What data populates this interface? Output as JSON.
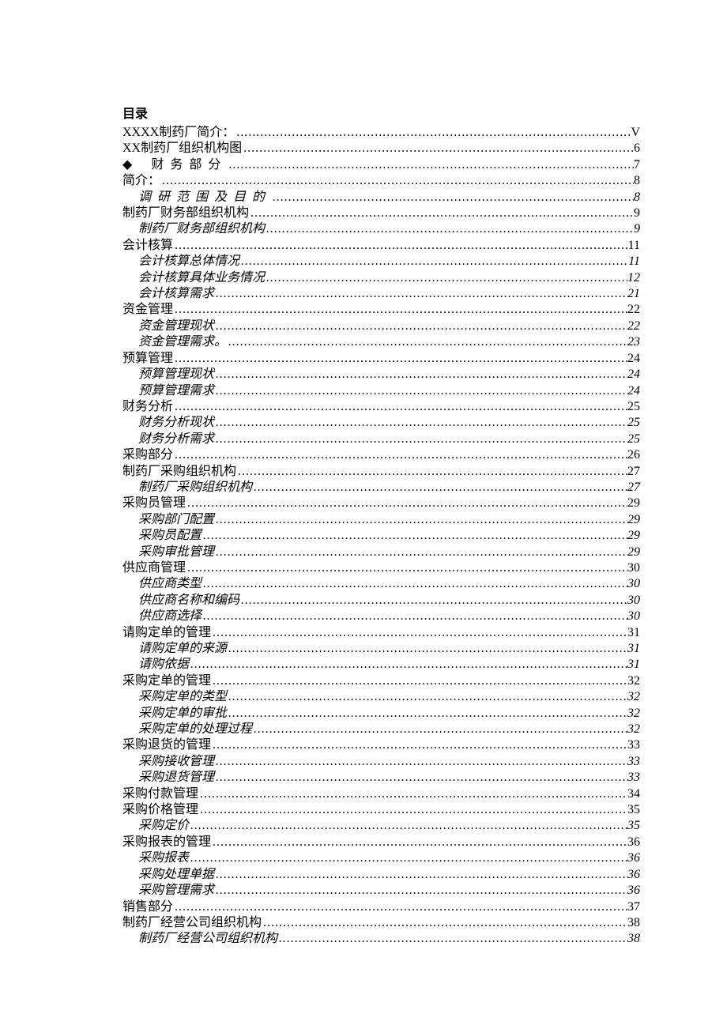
{
  "title": "目录",
  "entries": [
    {
      "level": 1,
      "label": "XXXX制药厂简介：",
      "page": "V",
      "spaced": false
    },
    {
      "level": 1,
      "label": "XX制药厂组织机构图",
      "page": "6",
      "spaced": false
    },
    {
      "level": 1,
      "label": "财务部分",
      "page": "7",
      "spaced": true,
      "bullet": "◆"
    },
    {
      "level": 1,
      "label": "简介：",
      "page": "8",
      "spaced": false
    },
    {
      "level": 2,
      "label": "调研范围及目的",
      "page": "8",
      "spaced": true
    },
    {
      "level": 1,
      "label": "制药厂财务部组织机构",
      "page": "9",
      "spaced": false
    },
    {
      "level": 2,
      "label": "制药厂财务部组织机构",
      "page": "9",
      "spaced": false
    },
    {
      "level": 1,
      "label": "会计核算",
      "page": "11",
      "spaced": false
    },
    {
      "level": 2,
      "label": "会计核算总体情况",
      "page": "11",
      "spaced": false
    },
    {
      "level": 2,
      "label": "会计核算具体业务情况",
      "page": "12",
      "spaced": false
    },
    {
      "level": 2,
      "label": "会计核算需求",
      "page": "21",
      "spaced": false
    },
    {
      "level": 1,
      "label": "资金管理",
      "page": "22",
      "spaced": false
    },
    {
      "level": 2,
      "label": "资金管理现状",
      "page": "22",
      "spaced": false
    },
    {
      "level": 2,
      "label": "资金管理需求。",
      "page": "23",
      "spaced": false
    },
    {
      "level": 1,
      "label": "预算管理",
      "page": "24",
      "spaced": false
    },
    {
      "level": 2,
      "label": "预算管理现状",
      "page": "24",
      "spaced": false
    },
    {
      "level": 2,
      "label": "预算管理需求",
      "page": "24",
      "spaced": false
    },
    {
      "level": 1,
      "label": "财务分析",
      "page": "25",
      "spaced": false
    },
    {
      "level": 2,
      "label": "财务分析现状",
      "page": "25",
      "spaced": false
    },
    {
      "level": 2,
      "label": "财务分析需求",
      "page": "25",
      "spaced": false
    },
    {
      "level": 1,
      "label": "采购部分",
      "page": "26",
      "spaced": false
    },
    {
      "level": 1,
      "label": "制药厂采购组织机构",
      "page": "27",
      "spaced": false
    },
    {
      "level": 2,
      "label": "制药厂采购组织机构",
      "page": "27",
      "spaced": false
    },
    {
      "level": 1,
      "label": "采购员管理",
      "page": "29",
      "spaced": false
    },
    {
      "level": 2,
      "label": "采购部门配置",
      "page": "29",
      "spaced": false
    },
    {
      "level": 2,
      "label": "采购员配置",
      "page": "29",
      "spaced": false
    },
    {
      "level": 2,
      "label": "采购审批管理",
      "page": "29",
      "spaced": false
    },
    {
      "level": 1,
      "label": "供应商管理",
      "page": "30",
      "spaced": false
    },
    {
      "level": 2,
      "label": "供应商类型",
      "page": "30",
      "spaced": false
    },
    {
      "level": 2,
      "label": "供应商名称和编码",
      "page": "30",
      "spaced": false
    },
    {
      "level": 2,
      "label": "供应商选择",
      "page": "30",
      "spaced": false
    },
    {
      "level": 1,
      "label": "请购定单的管理",
      "page": "31",
      "spaced": false
    },
    {
      "level": 2,
      "label": "请购定单的来源",
      "page": "31",
      "spaced": false
    },
    {
      "level": 2,
      "label": "请购依据",
      "page": "31",
      "spaced": false
    },
    {
      "level": 1,
      "label": "采购定单的管理",
      "page": "32",
      "spaced": false
    },
    {
      "level": 2,
      "label": "采购定单的类型",
      "page": "32",
      "spaced": false
    },
    {
      "level": 2,
      "label": "采购定单的审批",
      "page": "32",
      "spaced": false
    },
    {
      "level": 2,
      "label": "采购定单的处理过程",
      "page": "32",
      "spaced": false
    },
    {
      "level": 1,
      "label": "采购退货的管理",
      "page": "33",
      "spaced": false
    },
    {
      "level": 2,
      "label": "采购接收管理",
      "page": "33",
      "spaced": false
    },
    {
      "level": 2,
      "label": "采购退货管理",
      "page": "33",
      "spaced": false
    },
    {
      "level": 1,
      "label": "采购付款管理",
      "page": "34",
      "spaced": false
    },
    {
      "level": 1,
      "label": "采购价格管理",
      "page": "35",
      "spaced": false
    },
    {
      "level": 2,
      "label": "采购定价",
      "page": "35",
      "spaced": false
    },
    {
      "level": 1,
      "label": "采购报表的管理",
      "page": "36",
      "spaced": false
    },
    {
      "level": 2,
      "label": "采购报表",
      "page": "36",
      "spaced": false
    },
    {
      "level": 2,
      "label": "采购处理单据",
      "page": "36",
      "spaced": false
    },
    {
      "level": 2,
      "label": "采购管理需求",
      "page": "36",
      "spaced": false
    },
    {
      "level": 1,
      "label": "销售部分",
      "page": "37",
      "spaced": false
    },
    {
      "level": 1,
      "label": "制药厂经营公司组织机构",
      "page": "38",
      "spaced": false
    },
    {
      "level": 2,
      "label": "制药厂经营公司组织机构",
      "page": "38",
      "spaced": false
    }
  ]
}
